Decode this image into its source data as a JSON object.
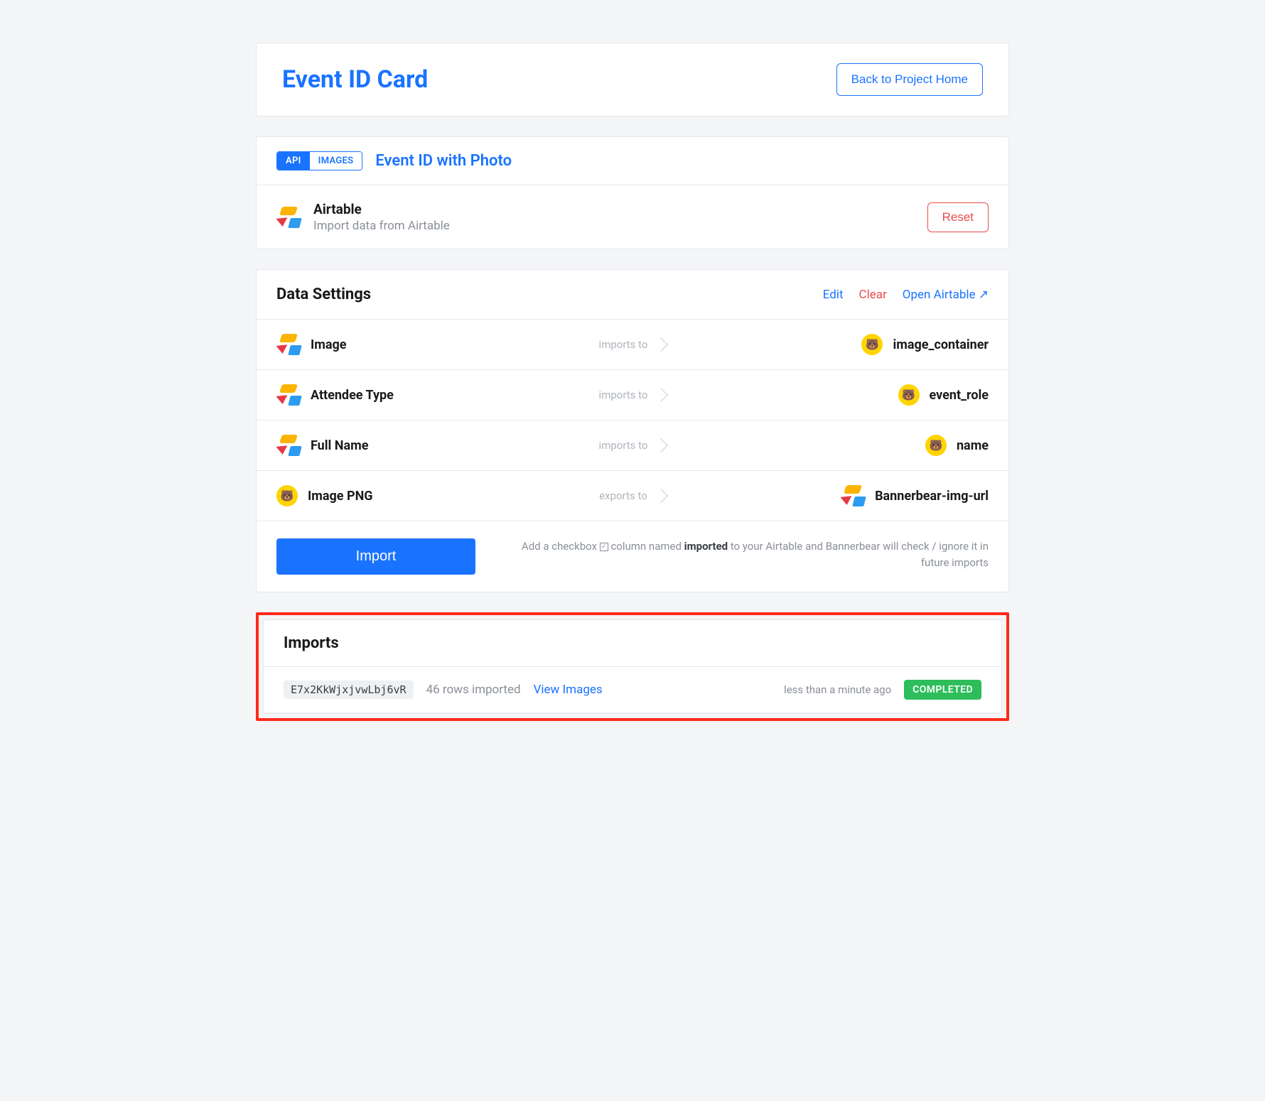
{
  "header": {
    "title": "Event ID Card",
    "back_label": "Back to Project Home"
  },
  "template_row": {
    "toggle_a": "API",
    "toggle_b": "IMAGES",
    "template_name": "Event ID with Photo"
  },
  "source": {
    "name": "Airtable",
    "description": "Import data from Airtable",
    "reset_label": "Reset"
  },
  "settings": {
    "title": "Data Settings",
    "edit_label": "Edit",
    "clear_label": "Clear",
    "open_label": "Open Airtable ↗"
  },
  "mappings": [
    {
      "left_icon": "airtable",
      "left": "Image",
      "mid": "imports to",
      "right_icon": "bannerbear",
      "right": "image_container"
    },
    {
      "left_icon": "airtable",
      "left": "Attendee Type",
      "mid": "imports to",
      "right_icon": "bannerbear",
      "right": "event_role"
    },
    {
      "left_icon": "airtable",
      "left": "Full Name",
      "mid": "imports to",
      "right_icon": "bannerbear",
      "right": "name"
    },
    {
      "left_icon": "bannerbear",
      "left": "Image PNG",
      "mid": "exports to",
      "right_icon": "airtable",
      "right": "Bannerbear-img-url"
    }
  ],
  "action": {
    "import_label": "Import",
    "helper_pre": "Add a checkbox ",
    "helper_mid": " column named ",
    "helper_bold": "imported",
    "helper_post": " to your Airtable and Bannerbear will check / ignore it in future imports"
  },
  "imports": {
    "title": "Imports",
    "row": {
      "id": "E7x2KkWjxjvwLbj6vR",
      "summary": "46 rows imported",
      "view_label": "View Images",
      "time": "less than a minute ago",
      "status": "COMPLETED"
    }
  }
}
